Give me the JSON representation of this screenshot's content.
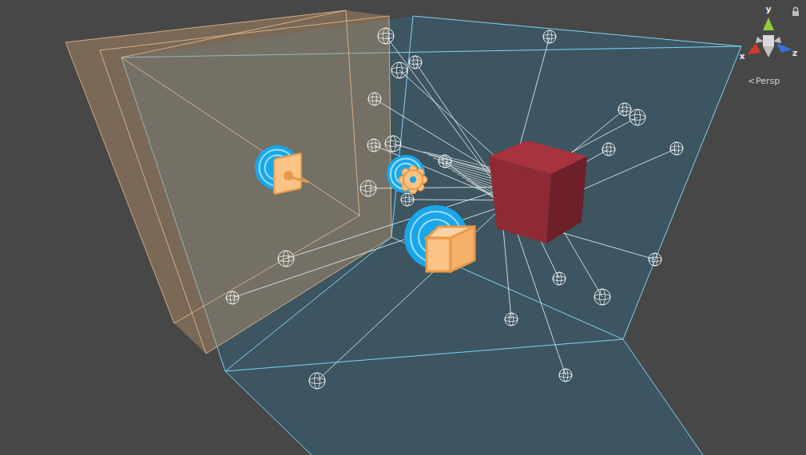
{
  "scene_view": {
    "projection": {
      "icon": "<",
      "label": "Persp"
    },
    "gizmo": {
      "locked": true,
      "axes": [
        {
          "label": "y",
          "color": "#8ccc3a"
        },
        {
          "label": "x",
          "color": "#d23a2a"
        },
        {
          "label": "z",
          "color": "#3a6fd8"
        }
      ]
    }
  }
}
